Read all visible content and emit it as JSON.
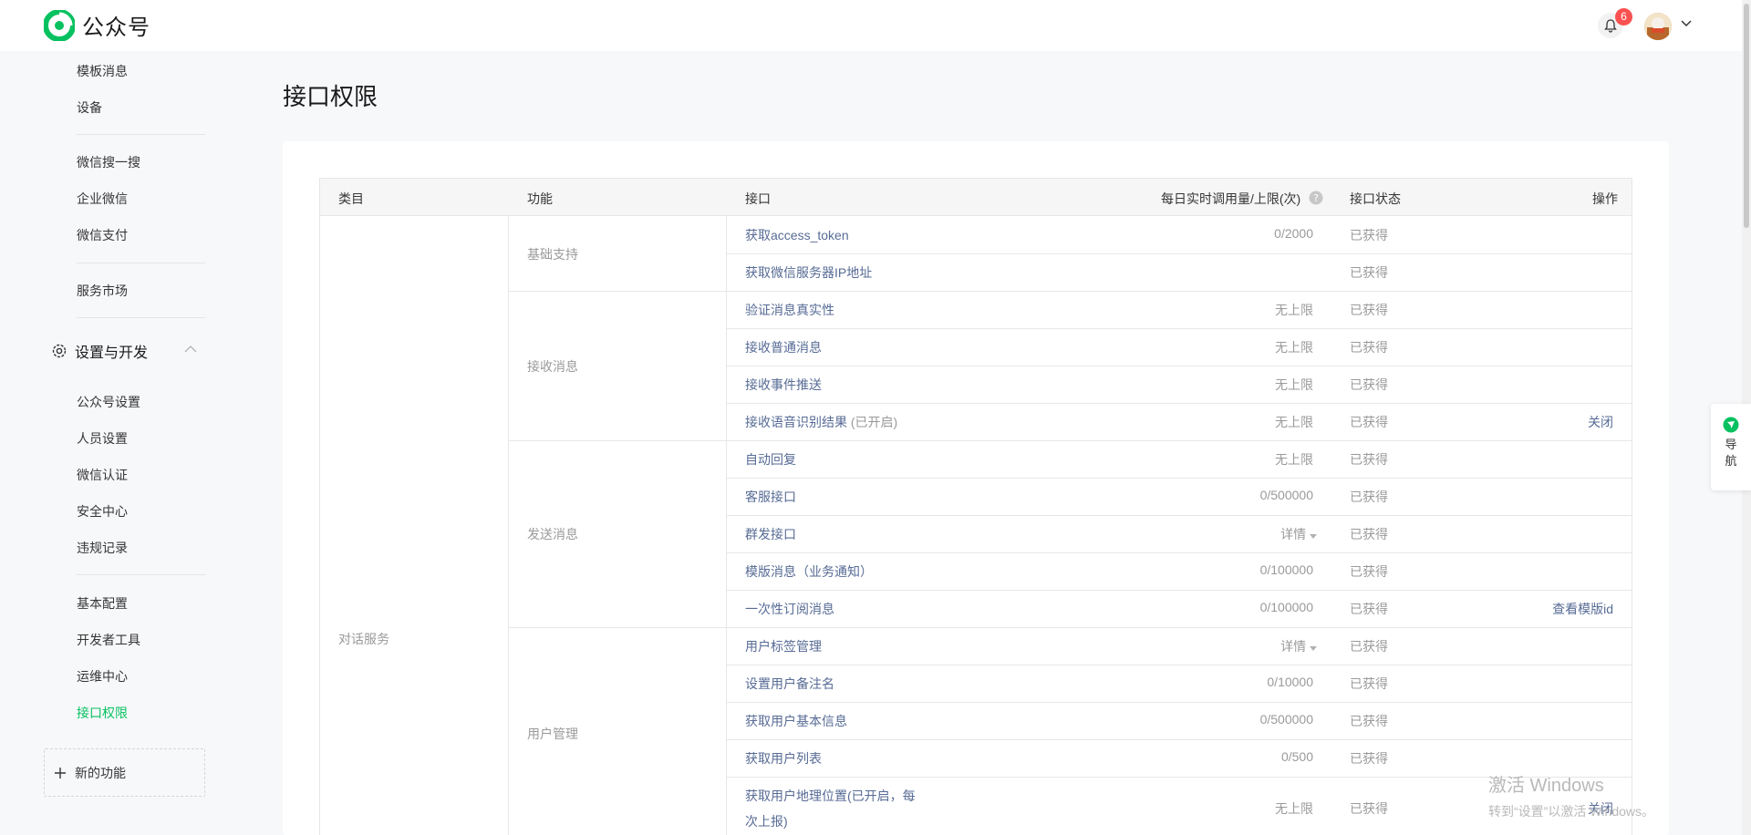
{
  "header": {
    "app_title": "公众号",
    "notification_count": "6",
    "brand_color": "#07c160"
  },
  "sidebar": {
    "items_top": [
      {
        "label": "模板消息"
      },
      {
        "label": "设备"
      }
    ],
    "items_mid1": [
      {
        "label": "微信搜一搜"
      },
      {
        "label": "企业微信"
      },
      {
        "label": "微信支付"
      }
    ],
    "items_mid2": [
      {
        "label": "服务市场"
      }
    ],
    "group": {
      "label": "设置与开发",
      "expanded": true
    },
    "group_items_a": [
      {
        "label": "公众号设置"
      },
      {
        "label": "人员设置"
      },
      {
        "label": "微信认证"
      },
      {
        "label": "安全中心"
      },
      {
        "label": "违规记录"
      }
    ],
    "group_items_b": [
      {
        "label": "基本配置"
      },
      {
        "label": "开发者工具"
      },
      {
        "label": "运维中心"
      },
      {
        "label": "接口权限",
        "active": true
      }
    ],
    "new_feature_label": "新的功能"
  },
  "page": {
    "title": "接口权限"
  },
  "table": {
    "headers": {
      "category": "类目",
      "function": "功能",
      "api": "接口",
      "quota": "每日实时调用量/上限(次)",
      "status": "接口状态",
      "operation": "操作"
    },
    "category": "对话服务",
    "groups": [
      {
        "function": "基础支持",
        "rows": [
          {
            "api": "获取access_token",
            "quota": "0/2000",
            "status": "已获得",
            "op": ""
          },
          {
            "api": "获取微信服务器IP地址",
            "quota": "",
            "status": "已获得",
            "op": ""
          }
        ]
      },
      {
        "function": "接收消息",
        "rows": [
          {
            "api": "验证消息真实性",
            "quota": "无上限",
            "status": "已获得",
            "op": ""
          },
          {
            "api": "接收普通消息",
            "quota": "无上限",
            "status": "已获得",
            "op": ""
          },
          {
            "api": "接收事件推送",
            "quota": "无上限",
            "status": "已获得",
            "op": ""
          },
          {
            "api": "接收语音识别结果",
            "api_suffix": "(已开启)",
            "quota": "无上限",
            "status": "已获得",
            "op": "关闭"
          }
        ]
      },
      {
        "function": "发送消息",
        "rows": [
          {
            "api": "自动回复",
            "quota": "无上限",
            "status": "已获得",
            "op": ""
          },
          {
            "api": "客服接口",
            "quota": "0/500000",
            "status": "已获得",
            "op": ""
          },
          {
            "api": "群发接口",
            "quota": "详情",
            "quota_dropdown": true,
            "status": "已获得",
            "op": ""
          },
          {
            "api": "模版消息（业务通知）",
            "quota": "0/100000",
            "status": "已获得",
            "op": ""
          },
          {
            "api": "一次性订阅消息",
            "quota": "0/100000",
            "status": "已获得",
            "op": "查看模版id"
          }
        ]
      },
      {
        "function": "用户管理",
        "rows": [
          {
            "api": "用户标签管理",
            "quota": "详情",
            "quota_dropdown": true,
            "status": "已获得",
            "op": ""
          },
          {
            "api": "设置用户备注名",
            "quota": "0/10000",
            "status": "已获得",
            "op": ""
          },
          {
            "api": "获取用户基本信息",
            "quota": "0/500000",
            "status": "已获得",
            "op": ""
          },
          {
            "api": "获取用户列表",
            "quota": "0/500",
            "status": "已获得",
            "op": ""
          },
          {
            "api": "获取用户地理位置(已开启，每次上报)",
            "api_line1": "获取用户地理位置(已开启，每",
            "api_line2": "次上报)",
            "quota": "无上限",
            "status": "已获得",
            "op": "关闭"
          }
        ]
      }
    ]
  },
  "float_nav": {
    "label": "导航"
  },
  "watermark": {
    "title": "激活 Windows",
    "subtitle": "转到“设置”以激活 Windows。"
  }
}
